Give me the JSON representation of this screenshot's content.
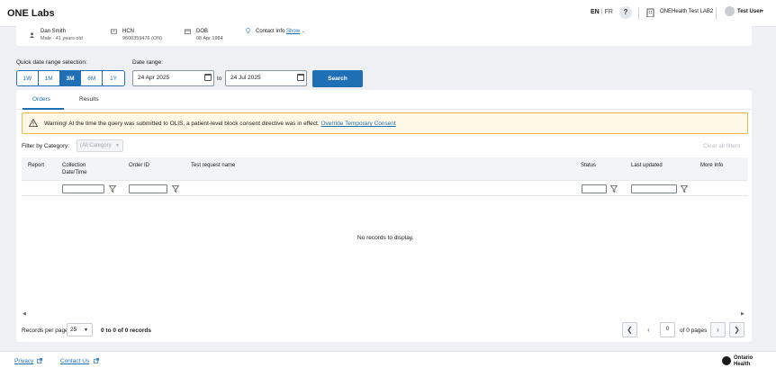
{
  "header": {
    "brand": "ONE Labs",
    "lang_active": "EN",
    "lang_sep": "|",
    "lang_other": "FR",
    "help": "?",
    "org_name": "ONEHealth Test LAB2",
    "user_name": "Test User",
    "user_caret": "▾"
  },
  "patient": {
    "name": "Dan Smith",
    "demographics": "Male · 41 years old",
    "hcn_label": "HCN",
    "hcn_value": "9600359476 (ON)",
    "dob_label": "DOB",
    "dob_value": "08 Apr 1984",
    "contact_label": "Contact Info",
    "contact_show": "Show"
  },
  "date_filter": {
    "quick_label": "Quick date range selection:",
    "quick_options": [
      "1W",
      "1M",
      "3M",
      "6M",
      "1Y"
    ],
    "quick_selected": "3M",
    "range_label": "Date range:",
    "from": "24 Apr 2025",
    "to_label": "to",
    "to": "24 Jul 2025",
    "search_label": "Search"
  },
  "tabs": [
    "Orders",
    "Results"
  ],
  "active_tab": "Orders",
  "warning": {
    "text": "Warning! At the time the query was submitted to OLIS, a patient-level block consent directive was in effect.",
    "link": "Override Temporary Consent"
  },
  "filter": {
    "label": "Filter by Category:",
    "placeholder": "(All Category",
    "clear_label": "Clear all filters"
  },
  "table": {
    "columns": [
      "Report",
      "Collection Date/Time",
      "Order ID",
      "Test request name",
      "Status",
      "Last updated",
      "More Info"
    ],
    "empty_message": "No records to display."
  },
  "pagination": {
    "rpp_label": "Records per page:",
    "rpp_value": "25",
    "record_count": "0 to 0 of 0 records",
    "page_value": "0",
    "page_of": "of 0 pages"
  },
  "footer": {
    "privacy": "Privacy",
    "contact": "Contact Us",
    "logo_line1": "Ontario",
    "logo_line2": "Health"
  },
  "colors": {
    "accent": "#1f6fb5",
    "warning_bg": "#fff8e6",
    "warning_border": "#e8b84d"
  }
}
